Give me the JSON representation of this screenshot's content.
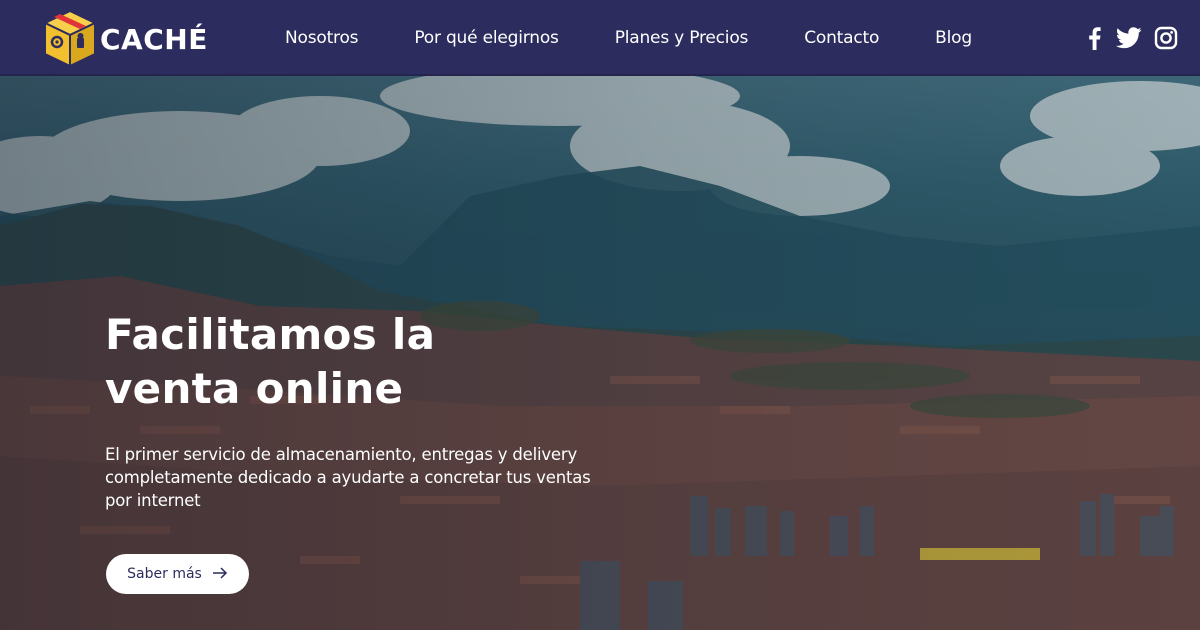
{
  "brand": {
    "name": "CACHÉ",
    "logo_icon": "box-logo-icon"
  },
  "nav": {
    "items": [
      {
        "label": "Nosotros"
      },
      {
        "label": "Por qué elegirnos"
      },
      {
        "label": "Planes y Precios"
      },
      {
        "label": "Contacto"
      },
      {
        "label": "Blog"
      }
    ]
  },
  "social": [
    {
      "icon": "facebook-icon"
    },
    {
      "icon": "twitter-icon"
    },
    {
      "icon": "instagram-icon"
    }
  ],
  "hero": {
    "title_line1": "Facilitamos la",
    "title_line2": "venta online",
    "subtitle": "El primer servicio de almacenamiento, entregas y delivery completamente dedicado a ayudarte a concretar tus ventas por internet",
    "cta_label": "Saber más"
  },
  "colors": {
    "navbar_bg": "#2c2c5e",
    "text_light": "#ffffff",
    "logo_yellow": "#f2c02f",
    "logo_red": "#e0343a",
    "cta_text": "#2c2c5e"
  }
}
